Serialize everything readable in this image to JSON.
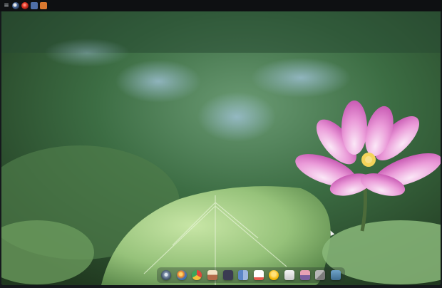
{
  "topbar": {
    "icons": [
      "menu-icon",
      "browser-icon",
      "red-app-icon",
      "window-icon",
      "orange-app-icon"
    ]
  },
  "wallpaper": {
    "subject": "pink-lotus-flower-with-green-lotus-leaf"
  },
  "dock": {
    "items": [
      {
        "name": "launcher-icon"
      },
      {
        "name": "firefox-icon"
      },
      {
        "name": "chrome-icon"
      },
      {
        "name": "photo-viewer-icon"
      },
      {
        "name": "terminal-icon"
      },
      {
        "name": "file-manager-icon"
      },
      {
        "name": "notes-icon"
      },
      {
        "name": "chat-icon"
      },
      {
        "name": "document-viewer-icon"
      },
      {
        "name": "media-player-icon"
      },
      {
        "name": "settings-tools-icon"
      },
      {
        "name": "display-settings-icon"
      }
    ]
  },
  "colors": {
    "lotus_pink": "#e88bd3",
    "leaf_green": "#a9d08a",
    "background_green": "#3f6f44"
  }
}
